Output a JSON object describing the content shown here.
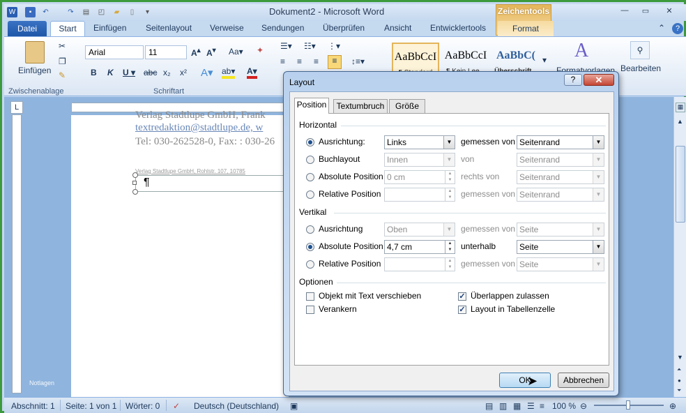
{
  "app": {
    "title": "Dokument2 - Microsoft Word",
    "contextual_tab_group": "Zeichentools"
  },
  "tabs": [
    "Datei",
    "Start",
    "Einfügen",
    "Seitenlayout",
    "Verweise",
    "Sendungen",
    "Überprüfen",
    "Ansicht",
    "Entwicklertools",
    "Format"
  ],
  "ribbon": {
    "clipboard": {
      "paste": "Einfügen",
      "group": "Zwischenablage"
    },
    "font": {
      "name": "Arial",
      "size": "11",
      "group": "Schriftart"
    },
    "styles": [
      {
        "preview": "AaBbCcI",
        "caption": "¶ Standard"
      },
      {
        "preview": "AaBbCcI",
        "caption": "¶ Kein Lee..."
      },
      {
        "preview": "AaBbC(",
        "caption": "Überschrift..."
      }
    ],
    "formatvorlagen": "Formatvorlagen",
    "bearbeiten": "Bearbeiten"
  },
  "document": {
    "line1": "Verlag Stadtlupe GmbH, Frank",
    "line2": "textredaktion@stadtlupe.de, w",
    "line3": "Tel: 030-262528-0, Fax: : 030-26",
    "line4": "Verlag Stadtlupe GmbH, Rohlstr. 107, 10785",
    "para_mark": "¶",
    "margin_label": "Notlagen"
  },
  "statusbar": {
    "section": "Abschnitt: 1",
    "page": "Seite: 1 von 1",
    "words": "Wörter: 0",
    "language": "Deutsch (Deutschland)",
    "zoom": "100 %"
  },
  "dialog": {
    "title": "Layout",
    "help": "?",
    "tabs": [
      "Position",
      "Textumbruch",
      "Größe"
    ],
    "horizontal": {
      "heading": "Horizontal",
      "rows": [
        {
          "label": "Ausrichtung:",
          "value": "Links",
          "rel_label": "gemessen von",
          "rel_value": "Seitenrand"
        },
        {
          "label": "Buchlayout",
          "value": "Innen",
          "rel_label": "von",
          "rel_value": "Seitenrand"
        },
        {
          "label": "Absolute Position",
          "value": "0 cm",
          "rel_label": "rechts von",
          "rel_value": "Seitenrand"
        },
        {
          "label": "Relative Position",
          "value": "",
          "rel_label": "gemessen von",
          "rel_value": "Seitenrand"
        }
      ]
    },
    "vertical": {
      "heading": "Vertikal",
      "rows": [
        {
          "label": "Ausrichtung",
          "value": "Oben",
          "rel_label": "gemessen von",
          "rel_value": "Seite"
        },
        {
          "label": "Absolute Position",
          "value": "4,7 cm",
          "rel_label": "unterhalb",
          "rel_value": "Seite"
        },
        {
          "label": "Relative Position",
          "value": "",
          "rel_label": "gemessen von",
          "rel_value": "Seite"
        }
      ]
    },
    "options": {
      "heading": "Optionen",
      "move_with_text": "Objekt mit Text verschieben",
      "lock_anchor": "Verankern",
      "allow_overlap": "Überlappen zulassen",
      "layout_in_cell": "Layout in Tabellenzelle"
    },
    "ok": "OK",
    "cancel": "Abbrechen"
  }
}
